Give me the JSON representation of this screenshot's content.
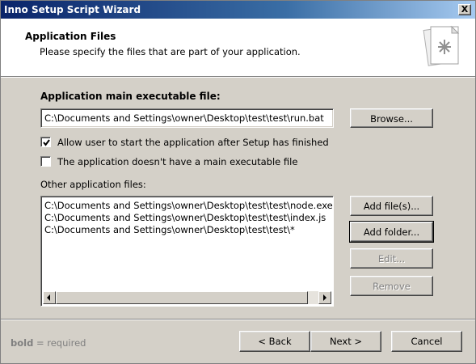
{
  "window": {
    "title": "Inno Setup Script Wizard",
    "close_label": "X"
  },
  "header": {
    "title": "Application Files",
    "subtitle": "Please specify the files that are part of your application."
  },
  "main_exe": {
    "label": "Application main executable file:",
    "value": "C:\\Documents and Settings\\owner\\Desktop\\test\\test\\run.bat",
    "browse_label": "Browse..."
  },
  "options": {
    "allow_start": {
      "label": "Allow user to start the application after Setup has finished",
      "checked": true
    },
    "no_main_exe": {
      "label": "The application doesn't have a main executable file",
      "checked": false
    }
  },
  "other_files": {
    "label": "Other application files:",
    "items": [
      "C:\\Documents and Settings\\owner\\Desktop\\test\\test\\node.exe",
      "C:\\Documents and Settings\\owner\\Desktop\\test\\test\\index.js",
      "C:\\Documents and Settings\\owner\\Desktop\\test\\test\\*"
    ],
    "buttons": {
      "add_files": "Add file(s)...",
      "add_folder": "Add folder...",
      "edit": "Edit...",
      "remove": "Remove"
    }
  },
  "footer": {
    "legend_bold": "bold",
    "legend_rest": " = required",
    "back": "< Back",
    "next": "Next >",
    "cancel": "Cancel"
  },
  "icons": [
    "close-icon",
    "wizard-page-icon",
    "check-icon",
    "scroll-left-icon",
    "scroll-right-icon"
  ]
}
